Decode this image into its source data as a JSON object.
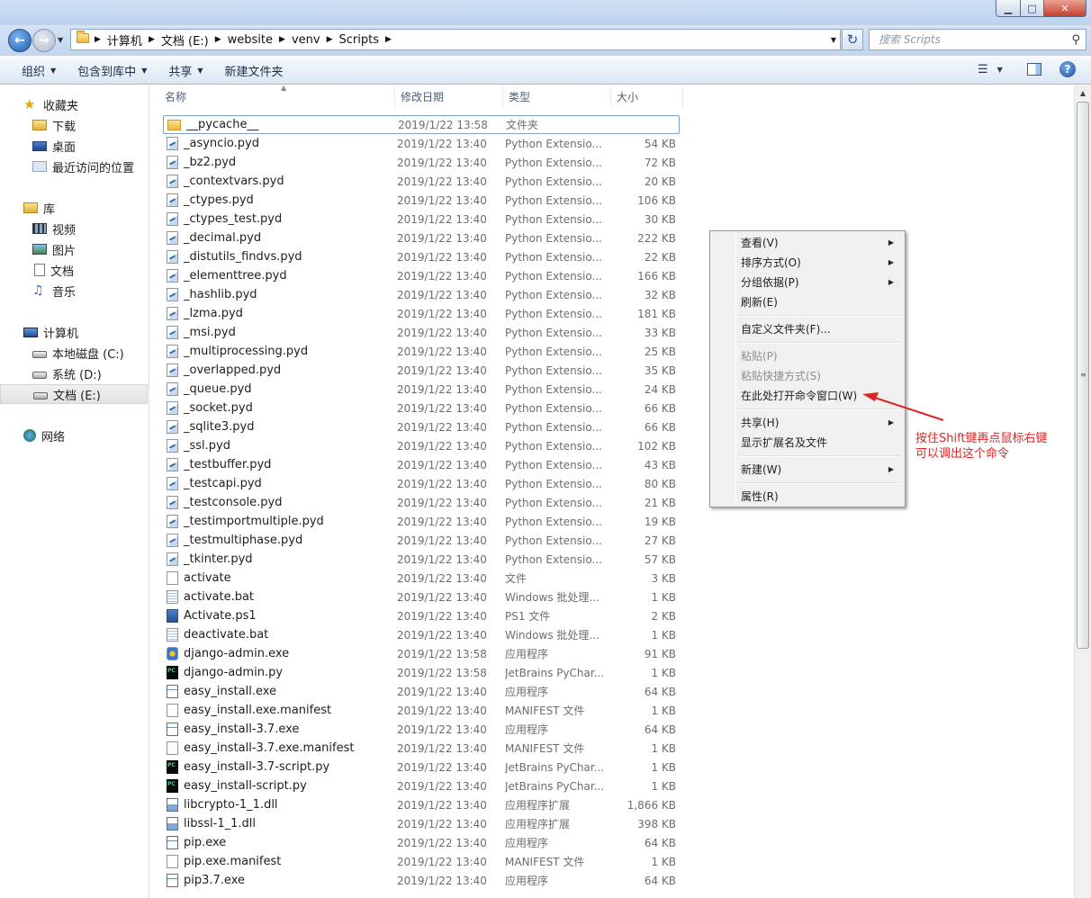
{
  "window": {
    "controls": {
      "minimize": "▁",
      "maximize": "□",
      "close": "✕"
    }
  },
  "address": {
    "crumbs": [
      "计算机",
      "文档 (E:)",
      "website",
      "venv",
      "Scripts"
    ],
    "search_placeholder": "搜索 Scripts"
  },
  "toolbar": {
    "organize": "组织",
    "include_library": "包含到库中",
    "share": "共享",
    "new_folder": "新建文件夹"
  },
  "nav": {
    "favorites": "收藏夹",
    "downloads": "下载",
    "desktop": "桌面",
    "recent": "最近访问的位置",
    "libraries": "库",
    "videos": "视频",
    "pictures": "图片",
    "documents": "文档",
    "music": "音乐",
    "computer": "计算机",
    "drive_c": "本地磁盘 (C:)",
    "drive_d": "系统 (D:)",
    "drive_e": "文档 (E:)",
    "network": "网络"
  },
  "columns": {
    "name": "名称",
    "date": "修改日期",
    "type": "类型",
    "size": "大小"
  },
  "files": [
    {
      "name": "__pycache__",
      "date": "2019/1/22 13:58",
      "type": "文件夹",
      "size": "",
      "icon": "folder"
    },
    {
      "name": "_asyncio.pyd",
      "date": "2019/1/22 13:40",
      "type": "Python Extensio...",
      "size": "54 KB",
      "icon": "pyd"
    },
    {
      "name": "_bz2.pyd",
      "date": "2019/1/22 13:40",
      "type": "Python Extensio...",
      "size": "72 KB",
      "icon": "pyd"
    },
    {
      "name": "_contextvars.pyd",
      "date": "2019/1/22 13:40",
      "type": "Python Extensio...",
      "size": "20 KB",
      "icon": "pyd"
    },
    {
      "name": "_ctypes.pyd",
      "date": "2019/1/22 13:40",
      "type": "Python Extensio...",
      "size": "106 KB",
      "icon": "pyd"
    },
    {
      "name": "_ctypes_test.pyd",
      "date": "2019/1/22 13:40",
      "type": "Python Extensio...",
      "size": "30 KB",
      "icon": "pyd"
    },
    {
      "name": "_decimal.pyd",
      "date": "2019/1/22 13:40",
      "type": "Python Extensio...",
      "size": "222 KB",
      "icon": "pyd"
    },
    {
      "name": "_distutils_findvs.pyd",
      "date": "2019/1/22 13:40",
      "type": "Python Extensio...",
      "size": "22 KB",
      "icon": "pyd"
    },
    {
      "name": "_elementtree.pyd",
      "date": "2019/1/22 13:40",
      "type": "Python Extensio...",
      "size": "166 KB",
      "icon": "pyd"
    },
    {
      "name": "_hashlib.pyd",
      "date": "2019/1/22 13:40",
      "type": "Python Extensio...",
      "size": "32 KB",
      "icon": "pyd"
    },
    {
      "name": "_lzma.pyd",
      "date": "2019/1/22 13:40",
      "type": "Python Extensio...",
      "size": "181 KB",
      "icon": "pyd"
    },
    {
      "name": "_msi.pyd",
      "date": "2019/1/22 13:40",
      "type": "Python Extensio...",
      "size": "33 KB",
      "icon": "pyd"
    },
    {
      "name": "_multiprocessing.pyd",
      "date": "2019/1/22 13:40",
      "type": "Python Extensio...",
      "size": "25 KB",
      "icon": "pyd"
    },
    {
      "name": "_overlapped.pyd",
      "date": "2019/1/22 13:40",
      "type": "Python Extensio...",
      "size": "35 KB",
      "icon": "pyd"
    },
    {
      "name": "_queue.pyd",
      "date": "2019/1/22 13:40",
      "type": "Python Extensio...",
      "size": "24 KB",
      "icon": "pyd"
    },
    {
      "name": "_socket.pyd",
      "date": "2019/1/22 13:40",
      "type": "Python Extensio...",
      "size": "66 KB",
      "icon": "pyd"
    },
    {
      "name": "_sqlite3.pyd",
      "date": "2019/1/22 13:40",
      "type": "Python Extensio...",
      "size": "66 KB",
      "icon": "pyd"
    },
    {
      "name": "_ssl.pyd",
      "date": "2019/1/22 13:40",
      "type": "Python Extensio...",
      "size": "102 KB",
      "icon": "pyd"
    },
    {
      "name": "_testbuffer.pyd",
      "date": "2019/1/22 13:40",
      "type": "Python Extensio...",
      "size": "43 KB",
      "icon": "pyd"
    },
    {
      "name": "_testcapi.pyd",
      "date": "2019/1/22 13:40",
      "type": "Python Extensio...",
      "size": "80 KB",
      "icon": "pyd"
    },
    {
      "name": "_testconsole.pyd",
      "date": "2019/1/22 13:40",
      "type": "Python Extensio...",
      "size": "21 KB",
      "icon": "pyd"
    },
    {
      "name": "_testimportmultiple.pyd",
      "date": "2019/1/22 13:40",
      "type": "Python Extensio...",
      "size": "19 KB",
      "icon": "pyd"
    },
    {
      "name": "_testmultiphase.pyd",
      "date": "2019/1/22 13:40",
      "type": "Python Extensio...",
      "size": "27 KB",
      "icon": "pyd"
    },
    {
      "name": "_tkinter.pyd",
      "date": "2019/1/22 13:40",
      "type": "Python Extensio...",
      "size": "57 KB",
      "icon": "pyd"
    },
    {
      "name": "activate",
      "date": "2019/1/22 13:40",
      "type": "文件",
      "size": "3 KB",
      "icon": "blank"
    },
    {
      "name": "activate.bat",
      "date": "2019/1/22 13:40",
      "type": "Windows 批处理...",
      "size": "1 KB",
      "icon": "bat"
    },
    {
      "name": "Activate.ps1",
      "date": "2019/1/22 13:40",
      "type": "PS1 文件",
      "size": "2 KB",
      "icon": "ps1"
    },
    {
      "name": "deactivate.bat",
      "date": "2019/1/22 13:40",
      "type": "Windows 批处理...",
      "size": "1 KB",
      "icon": "bat"
    },
    {
      "name": "django-admin.exe",
      "date": "2019/1/22 13:58",
      "type": "应用程序",
      "size": "91 KB",
      "icon": "dj"
    },
    {
      "name": "django-admin.py",
      "date": "2019/1/22 13:58",
      "type": "JetBrains PyChar...",
      "size": "1 KB",
      "icon": "pc"
    },
    {
      "name": "easy_install.exe",
      "date": "2019/1/22 13:40",
      "type": "应用程序",
      "size": "64 KB",
      "icon": "exe"
    },
    {
      "name": "easy_install.exe.manifest",
      "date": "2019/1/22 13:40",
      "type": "MANIFEST 文件",
      "size": "1 KB",
      "icon": "blank"
    },
    {
      "name": "easy_install-3.7.exe",
      "date": "2019/1/22 13:40",
      "type": "应用程序",
      "size": "64 KB",
      "icon": "exe"
    },
    {
      "name": "easy_install-3.7.exe.manifest",
      "date": "2019/1/22 13:40",
      "type": "MANIFEST 文件",
      "size": "1 KB",
      "icon": "blank"
    },
    {
      "name": "easy_install-3.7-script.py",
      "date": "2019/1/22 13:40",
      "type": "JetBrains PyChar...",
      "size": "1 KB",
      "icon": "pc"
    },
    {
      "name": "easy_install-script.py",
      "date": "2019/1/22 13:40",
      "type": "JetBrains PyChar...",
      "size": "1 KB",
      "icon": "pc"
    },
    {
      "name": "libcrypto-1_1.dll",
      "date": "2019/1/22 13:40",
      "type": "应用程序扩展",
      "size": "1,866 KB",
      "icon": "dll"
    },
    {
      "name": "libssl-1_1.dll",
      "date": "2019/1/22 13:40",
      "type": "应用程序扩展",
      "size": "398 KB",
      "icon": "dll"
    },
    {
      "name": "pip.exe",
      "date": "2019/1/22 13:40",
      "type": "应用程序",
      "size": "64 KB",
      "icon": "exe"
    },
    {
      "name": "pip.exe.manifest",
      "date": "2019/1/22 13:40",
      "type": "MANIFEST 文件",
      "size": "1 KB",
      "icon": "blank"
    },
    {
      "name": "pip3.7.exe",
      "date": "2019/1/22 13:40",
      "type": "应用程序",
      "size": "64 KB",
      "icon": "exe"
    }
  ],
  "context_menu": {
    "view": "查看(V)",
    "sort": "排序方式(O)",
    "group": "分组依据(P)",
    "refresh": "刷新(E)",
    "customize": "自定义文件夹(F)...",
    "paste": "粘贴(P)",
    "paste_shortcut": "粘贴快捷方式(S)",
    "open_cmd": "在此处打开命令窗口(W)",
    "share": "共享(H)",
    "show_ext": "显示扩展名及文件",
    "new": "新建(W)",
    "properties": "属性(R)"
  },
  "annotation": {
    "line1": "按住Shift键再点鼠标右键",
    "line2": "可以调出这个命令",
    "color": "#e02424"
  }
}
